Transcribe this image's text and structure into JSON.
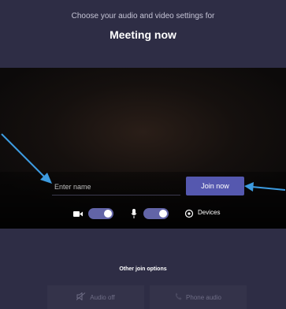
{
  "header": {
    "subtitle": "Choose your audio and video settings for",
    "title": "Meeting now"
  },
  "join_form": {
    "name_placeholder": "Enter name",
    "name_value": "",
    "join_label": "Join now"
  },
  "controls": {
    "camera_on": true,
    "mic_on": true,
    "devices_label": "Devices"
  },
  "other_options": {
    "heading": "Other join options",
    "audio_off_label": "Audio off",
    "phone_audio_label": "Phone audio"
  },
  "colors": {
    "background": "#2e2d45",
    "accent": "#5558af",
    "toggle_on": "#6264a7",
    "annotation_arrow": "#3d9be0"
  },
  "icons": [
    "camera-icon",
    "microphone-icon",
    "gear-icon",
    "audio-off-icon",
    "phone-icon",
    "arrow-icon"
  ]
}
